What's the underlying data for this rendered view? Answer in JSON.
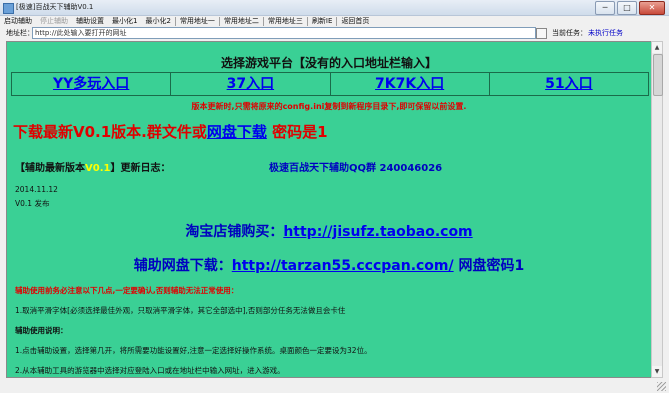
{
  "window": {
    "title": "[极速]百战天下辅助V0.1",
    "buttons": {
      "minimize": "─",
      "maximize": "□",
      "close": "✕"
    }
  },
  "menu": [
    {
      "label": "启动辅助",
      "enabled": true
    },
    {
      "label": "停止辅助",
      "enabled": false
    },
    {
      "label": "辅助设置",
      "enabled": true
    },
    {
      "label": "最小化1",
      "enabled": true
    },
    {
      "label": "最小化2",
      "enabled": true
    },
    {
      "label": "常用地址一",
      "enabled": true
    },
    {
      "label": "常用地址二",
      "enabled": true
    },
    {
      "label": "常用地址三",
      "enabled": true
    },
    {
      "label": "刷新IE",
      "enabled": true
    },
    {
      "label": "返回首页",
      "enabled": true
    }
  ],
  "address": {
    "label": "地址栏：",
    "value": "http://此处输入要打开的网址"
  },
  "task": {
    "label": "当前任务：",
    "value": "未执行任务"
  },
  "content": {
    "platform_title": "选择游戏平台【没有的入口地址栏输入】",
    "platforms": [
      "YY多玩入口",
      "37入口",
      "7K7K入口",
      "51入口"
    ],
    "notice": "版本更新时,只需将原来的config.ini复制到新程序目录下,即可保留以前设置.",
    "download": {
      "prefix": "下载最新V0.1版本.群文件或",
      "link": "网盘下载",
      "suffix": " 密码是1"
    },
    "changelog": {
      "prefix": "【辅助最新版本",
      "version": "V0.1",
      "suffix": "】更新日志：",
      "qq": "极速百战天下辅助QQ群 240046026",
      "date": "2014.11.12",
      "release": "V0.1 发布"
    },
    "shop": {
      "label": "淘宝店铺购买：",
      "link": "http://jisufz.taobao.com"
    },
    "disk": {
      "label": "辅助网盘下载：",
      "link": "http://tarzan55.cccpan.com/",
      "suffix": " 网盘密码1"
    },
    "warning": "辅助使用前务必注意以下几点,一定要确认,否则辅助无法正常使用：",
    "tip1": "1.取消平滑字体[必须选择最佳外观，只取消平滑字体，其它全部选中],否则部分任务无法做且会卡住",
    "guide_head": "辅助使用说明：",
    "step1": "1.点击辅助设置，选择第几开，将所需要功能设置好,注意一定选择好操作系统。桌面颜色一定要设为32位。",
    "step2": "2.从本辅助工具的游览器中选择对应登陆入口或在地址栏中输入网址，进入游戏。"
  },
  "colors": {
    "content_bg": "#3ad095",
    "link": "#0000ee",
    "red": "#e00000",
    "blue_text": "#0000c0",
    "version_yellow": "#ffff00"
  }
}
